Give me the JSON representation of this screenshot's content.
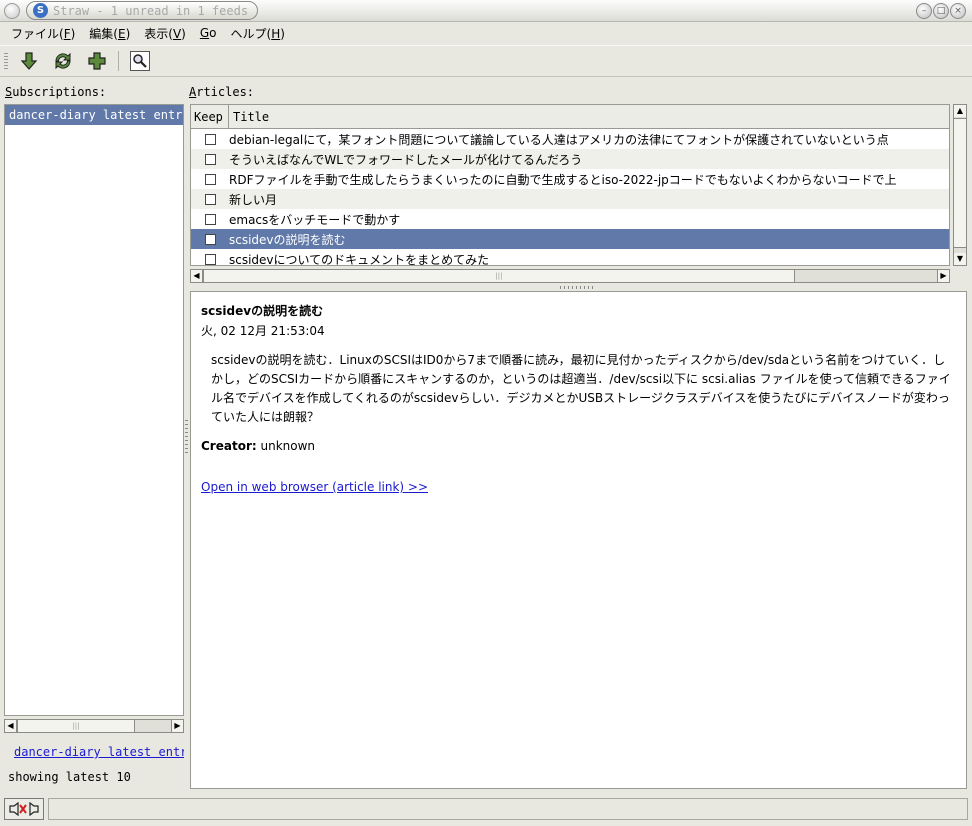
{
  "window": {
    "title": "Straw - 1 unread in 1 feeds",
    "app_logo": "S"
  },
  "menu": [
    {
      "label": "ファイル(",
      "key": "F",
      "end": ")"
    },
    {
      "label": "編集(",
      "key": "E",
      "end": ")"
    },
    {
      "label": "表示(",
      "key": "V",
      "end": ")"
    },
    {
      "label": "",
      "key": "G",
      "end": "o"
    },
    {
      "label": "ヘルプ(",
      "key": "H",
      "end": ")"
    }
  ],
  "toolbar": {
    "icons": [
      "go-down-icon",
      "refresh-icon",
      "add-icon",
      "find-icon"
    ]
  },
  "subscriptions": {
    "label_key": "S",
    "label_rest": "ubscriptions:",
    "items": [
      "dancer-diary latest entri"
    ],
    "feed_link": "dancer-diary latest entr",
    "showing": "showing latest 10"
  },
  "articles": {
    "label_key": "A",
    "label_rest": "rticles:",
    "col_keep": "Keep",
    "col_title": "Title",
    "rows": [
      {
        "title": "debian-legalにて，某フォント問題について議論している人達はアメリカの法律にてフォントが保護されていないという点",
        "selected": false
      },
      {
        "title": "そういえばなんでWLでフォワードしたメールが化けてるんだろう",
        "selected": false
      },
      {
        "title": "RDFファイルを手動で生成したらうまくいったのに自動で生成するとiso-2022-jpコードでもないよくわからないコードで上",
        "selected": false
      },
      {
        "title": "新しい月",
        "selected": false
      },
      {
        "title": "emacsをバッチモードで動かす",
        "selected": false
      },
      {
        "title": "scsidevの説明を読む",
        "selected": true
      },
      {
        "title": "scsidevについてのドキュメントをまとめてみた",
        "selected": false
      }
    ]
  },
  "content": {
    "title": "scsidevの説明を読む",
    "date": "火, 02 12月 21:53:04",
    "body": "scsidevの説明を読む．LinuxのSCSIはID0から7まで順番に読み，最初に見付かったディスクから/dev/sdaという名前をつけていく．しかし，どのSCSIカードから順番にスキャンするのか，というのは超適当．/dev/scsi以下に scsi.alias ファイルを使って信頼できるファイル名でデバイスを作成してくれるのがscsidevらしい．デジカメとかUSBストレージクラスデバイスを使うたびにデバイスノードが変わっていた人には朗報？",
    "creator_label": "Creator:",
    "creator_value": "unknown",
    "link": "Open in web browser (article link) >>"
  },
  "status": {
    "offline_icon": "offline-icon",
    "text": ""
  }
}
